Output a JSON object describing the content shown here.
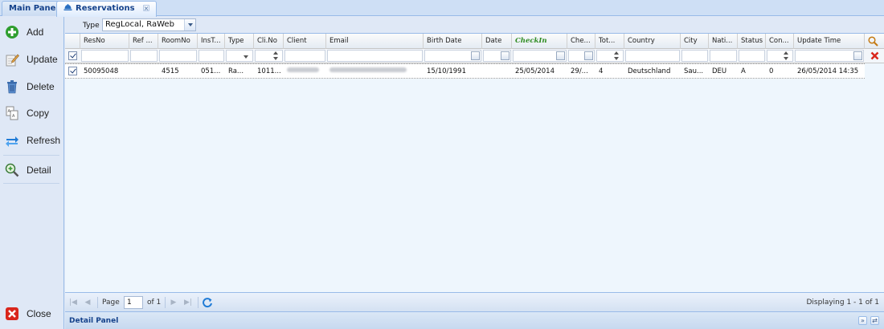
{
  "tabs": [
    {
      "label": "Main Panel"
    },
    {
      "label": "Reservations"
    }
  ],
  "sidebar": {
    "items": [
      {
        "label": "Add",
        "icon": "add-icon"
      },
      {
        "label": "Update",
        "icon": "edit-icon"
      },
      {
        "label": "Delete",
        "icon": "trash-icon"
      },
      {
        "label": "Copy",
        "icon": "copy-icon"
      },
      {
        "label": "Refresh",
        "icon": "refresh-icon"
      },
      {
        "label": "Detail",
        "icon": "magnifier-icon"
      }
    ],
    "close_label": "Close"
  },
  "filter": {
    "type_label": "Type",
    "type_value": "RegLocal, RaWeb"
  },
  "grid": {
    "columns": [
      "ResNo",
      "Ref ...",
      "RoomNo",
      "InsT...",
      "Type",
      "Cli.No",
      "Client",
      "Email",
      "Birth Date",
      "Date",
      "CheckIn",
      "Che...",
      "Tot...",
      "Country",
      "City",
      "Nati...",
      "Status",
      "Con...",
      "Update Time"
    ],
    "rows": [
      {
        "ResNo": "50095048",
        "Ref": "",
        "RoomNo": "4515",
        "InsT": "051...",
        "Type": "Ra...",
        "CliNo": "1011...",
        "Client": "",
        "Email": "",
        "BirthDate": "15/10/1991",
        "Date": "",
        "CheckIn": "25/05/2014",
        "Che": "29/...",
        "Tot": "4",
        "Country": "Deutschland",
        "City": "Sau...",
        "Nati": "DEU",
        "Status": "A",
        "Con": "0",
        "UpdateTime": "26/05/2014 14:35"
      }
    ]
  },
  "pager": {
    "page_label": "Page",
    "page_value": "1",
    "of_label": "of 1",
    "display_text": "Displaying 1 - 1 of 1"
  },
  "detail_panel": {
    "title": "Detail Panel"
  },
  "colors": {
    "accent": "#15428b",
    "checkin_header": "#2e8b21",
    "add_green": "#2f9e2f",
    "close_red": "#d9261c",
    "refresh_blue": "#1f7bd6"
  }
}
